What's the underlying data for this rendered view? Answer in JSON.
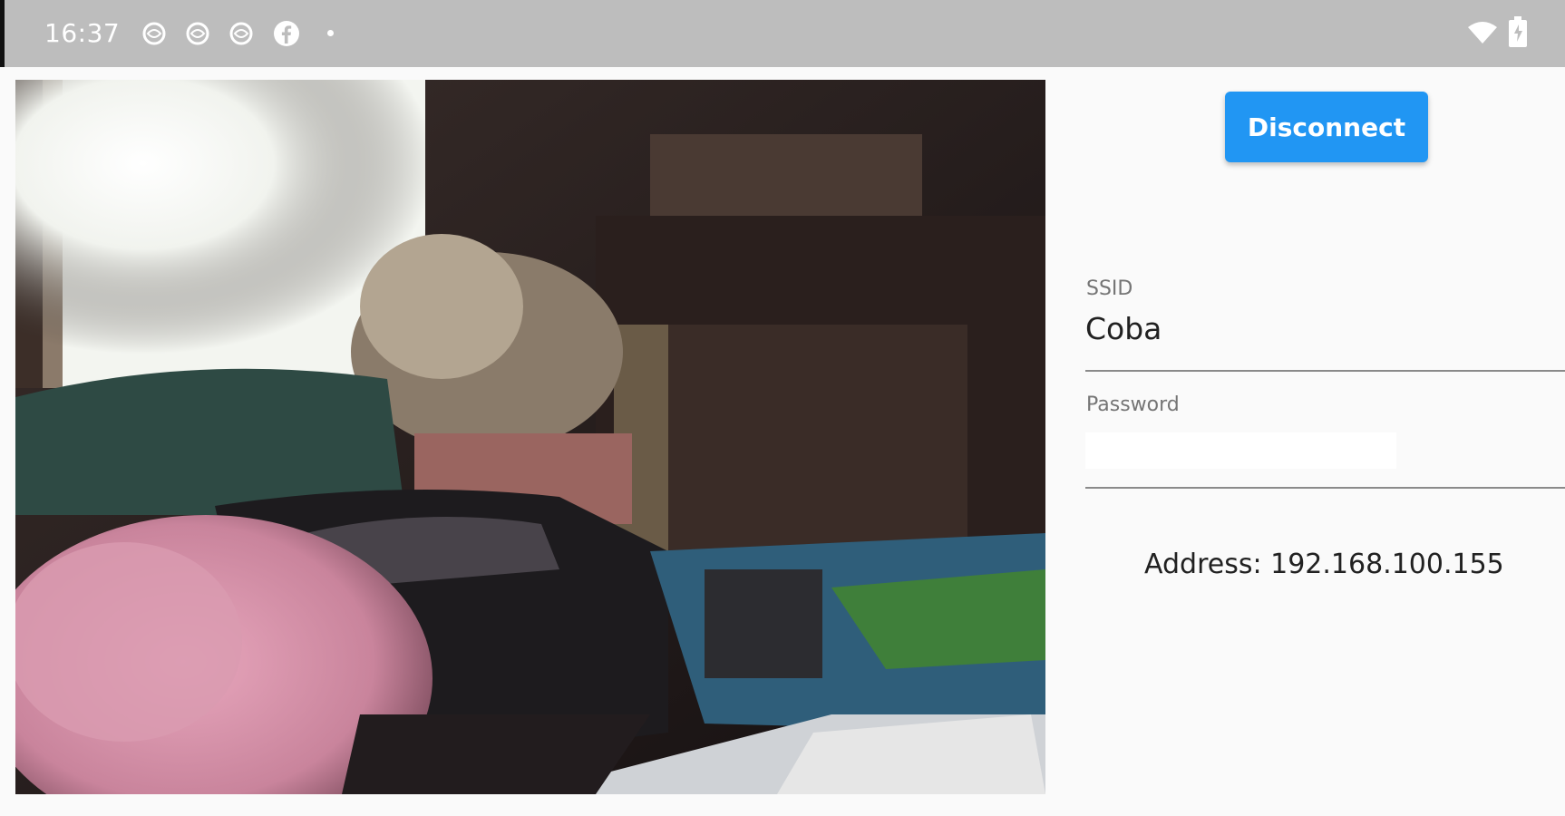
{
  "status_bar": {
    "time": "16:37",
    "notification_icons": [
      "notification-icon-1",
      "notification-icon-2",
      "notification-icon-3",
      "facebook-icon",
      "more-dot-icon"
    ],
    "system_icons": [
      "wifi-icon",
      "battery-icon"
    ]
  },
  "camera": {
    "icon": "camera-feed-image"
  },
  "controls": {
    "disconnect_label": "Disconnect",
    "accent_color": "#2196f3"
  },
  "ssid": {
    "label": "SSID",
    "value": "Coba"
  },
  "password": {
    "label": "Password",
    "value": ""
  },
  "address": {
    "text": "Address: 192.168.100.155"
  }
}
